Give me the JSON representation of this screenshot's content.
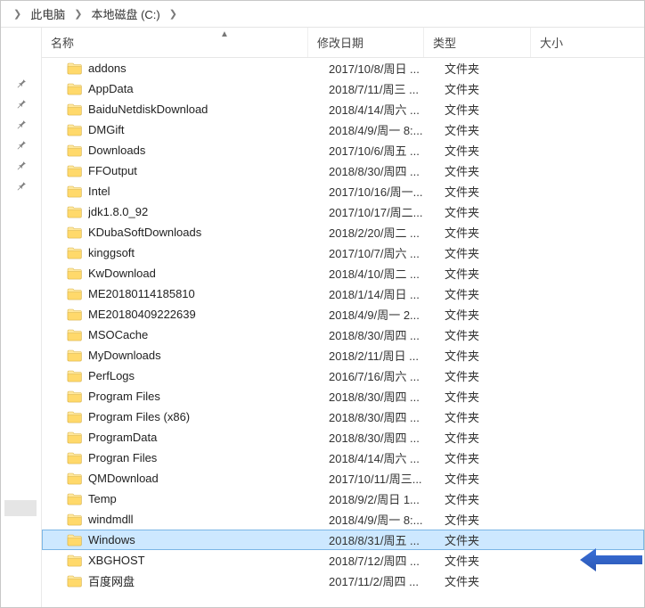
{
  "breadcrumb": {
    "items": [
      "此电脑",
      "本地磁盘 (C:)"
    ]
  },
  "columns": {
    "name": "名称",
    "date": "修改日期",
    "type": "类型",
    "size": "大小"
  },
  "selected_index": 23,
  "pinned_count": 6,
  "rows": [
    {
      "name": "addons",
      "date": "2017/10/8/周日 ...",
      "type": "文件夹",
      "size": ""
    },
    {
      "name": "AppData",
      "date": "2018/7/11/周三 ...",
      "type": "文件夹",
      "size": ""
    },
    {
      "name": "BaiduNetdiskDownload",
      "date": "2018/4/14/周六 ...",
      "type": "文件夹",
      "size": ""
    },
    {
      "name": "DMGift",
      "date": "2018/4/9/周一 8:...",
      "type": "文件夹",
      "size": ""
    },
    {
      "name": "Downloads",
      "date": "2017/10/6/周五 ...",
      "type": "文件夹",
      "size": ""
    },
    {
      "name": "FFOutput",
      "date": "2018/8/30/周四 ...",
      "type": "文件夹",
      "size": ""
    },
    {
      "name": "Intel",
      "date": "2017/10/16/周一...",
      "type": "文件夹",
      "size": ""
    },
    {
      "name": "jdk1.8.0_92",
      "date": "2017/10/17/周二...",
      "type": "文件夹",
      "size": ""
    },
    {
      "name": "KDubaSoftDownloads",
      "date": "2018/2/20/周二 ...",
      "type": "文件夹",
      "size": ""
    },
    {
      "name": "kinggsoft",
      "date": "2017/10/7/周六 ...",
      "type": "文件夹",
      "size": ""
    },
    {
      "name": "KwDownload",
      "date": "2018/4/10/周二 ...",
      "type": "文件夹",
      "size": ""
    },
    {
      "name": "ME20180114185810",
      "date": "2018/1/14/周日 ...",
      "type": "文件夹",
      "size": ""
    },
    {
      "name": "ME20180409222639",
      "date": "2018/4/9/周一 2...",
      "type": "文件夹",
      "size": ""
    },
    {
      "name": "MSOCache",
      "date": "2018/8/30/周四 ...",
      "type": "文件夹",
      "size": ""
    },
    {
      "name": "MyDownloads",
      "date": "2018/2/11/周日 ...",
      "type": "文件夹",
      "size": ""
    },
    {
      "name": "PerfLogs",
      "date": "2016/7/16/周六 ...",
      "type": "文件夹",
      "size": ""
    },
    {
      "name": "Program Files",
      "date": "2018/8/30/周四 ...",
      "type": "文件夹",
      "size": ""
    },
    {
      "name": "Program Files (x86)",
      "date": "2018/8/30/周四 ...",
      "type": "文件夹",
      "size": ""
    },
    {
      "name": "ProgramData",
      "date": "2018/8/30/周四 ...",
      "type": "文件夹",
      "size": ""
    },
    {
      "name": "Progran Files",
      "date": "2018/4/14/周六 ...",
      "type": "文件夹",
      "size": ""
    },
    {
      "name": "QMDownload",
      "date": "2017/10/11/周三...",
      "type": "文件夹",
      "size": ""
    },
    {
      "name": "Temp",
      "date": "2018/9/2/周日 1...",
      "type": "文件夹",
      "size": ""
    },
    {
      "name": "windmdll",
      "date": "2018/4/9/周一 8:...",
      "type": "文件夹",
      "size": ""
    },
    {
      "name": "Windows",
      "date": "2018/8/31/周五 ...",
      "type": "文件夹",
      "size": ""
    },
    {
      "name": "XBGHOST",
      "date": "2018/7/12/周四 ...",
      "type": "文件夹",
      "size": ""
    },
    {
      "name": "百度网盘",
      "date": "2017/11/2/周四 ...",
      "type": "文件夹",
      "size": ""
    }
  ]
}
